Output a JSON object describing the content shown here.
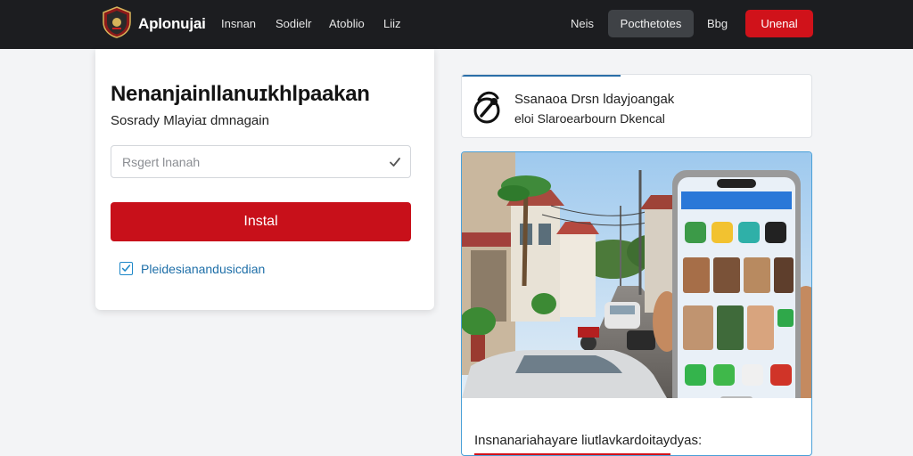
{
  "header": {
    "brand": "Aplonujai",
    "nav_links": [
      "Insnan",
      "Sodielr",
      "Atoblio",
      "Liiz"
    ],
    "nav_right_link1": "Neis",
    "nav_button_secondary": "Pocthetotes",
    "nav_right_link2": "Bbg",
    "nav_button_primary": "Unenal"
  },
  "form_card": {
    "title": "Nenanjainllanuɪkhlpaakan",
    "subtitle": "Sosrady Mlayiaɪ dmnagain",
    "input_placeholder": "Rsgert lnanah",
    "submit_label": "Instal",
    "checkbox_label": "Pleidesianandusicdian",
    "checkbox_checked": true
  },
  "info_card": {
    "line1": "Ssanaoa Drsn ldayjoangak",
    "line2": "eloi Slaroearbourn Dkencal"
  },
  "promo_card": {
    "caption": "Insnanariahayare liutlavkardoitaydyas:"
  },
  "colors": {
    "nav_bg": "#1c1d20",
    "accent_red": "#d0121a",
    "accent_blue": "#1e88c8"
  }
}
